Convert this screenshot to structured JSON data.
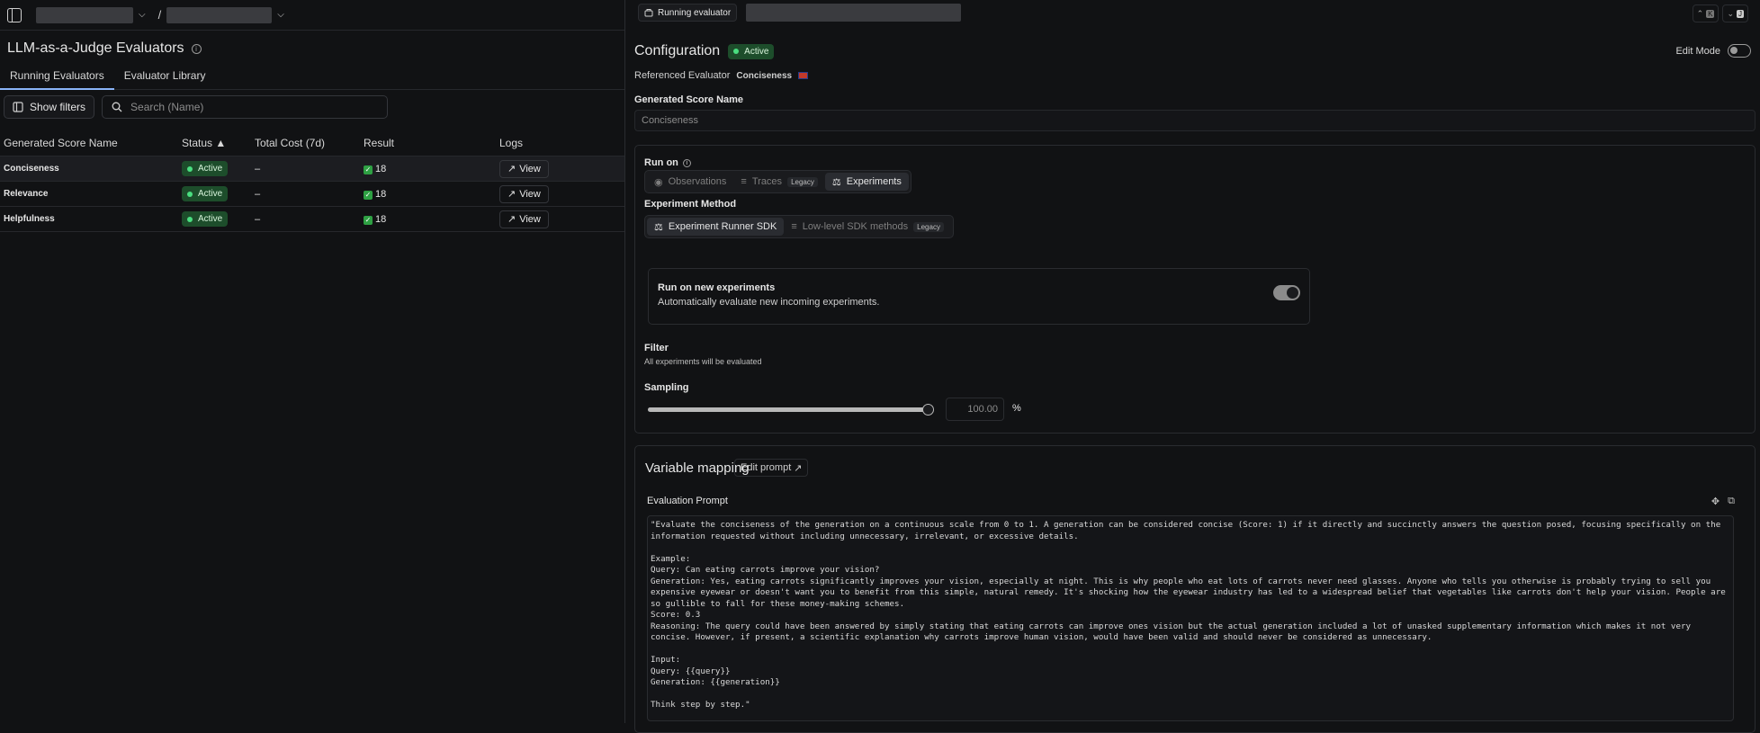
{
  "left": {
    "title": "LLM-as-a-Judge Evaluators",
    "tabs": [
      {
        "label": "Running Evaluators",
        "active": true
      },
      {
        "label": "Evaluator Library",
        "active": false
      }
    ],
    "show_filters_label": "Show filters",
    "search_placeholder": "Search (Name)",
    "columns": [
      "Generated Score Name",
      "Status ▲",
      "Total Cost (7d)",
      "Result",
      "Logs"
    ],
    "rows": [
      {
        "name": "Conciseness",
        "status": "Active",
        "cost": "–",
        "result": "18",
        "logs": "View"
      },
      {
        "name": "Relevance",
        "status": "Active",
        "cost": "–",
        "result": "18",
        "logs": "View"
      },
      {
        "name": "Helpfulness",
        "status": "Active",
        "cost": "–",
        "result": "18",
        "logs": "View"
      }
    ]
  },
  "right": {
    "top_chip": "Running evaluator",
    "nav_keys": [
      "K",
      "J"
    ],
    "config_title": "Configuration",
    "config_status": "Active",
    "edit_mode_label": "Edit Mode",
    "referenced_label": "Referenced Evaluator",
    "referenced_value": "Conciseness",
    "score_name_label": "Generated Score Name",
    "score_name_value": "Conciseness",
    "run_on_label": "Run on",
    "run_on_options": [
      {
        "label": "Observations",
        "active": false,
        "tag": ""
      },
      {
        "label": "Traces",
        "active": false,
        "tag": "Legacy"
      },
      {
        "label": "Experiments",
        "active": true,
        "tag": ""
      }
    ],
    "method_label": "Experiment Method",
    "method_options": [
      {
        "label": "Experiment Runner SDK",
        "active": true,
        "tag": ""
      },
      {
        "label": "Low-level SDK methods",
        "active": false,
        "tag": "Legacy"
      }
    ],
    "new_exp_title": "Run on new experiments",
    "new_exp_sub": "Automatically evaluate new incoming experiments.",
    "new_exp_enabled": true,
    "filter_label": "Filter",
    "filter_sub": "All experiments will be evaluated",
    "sampling_label": "Sampling",
    "sampling_value": "100.00",
    "sampling_fraction": 1.0,
    "sampling_unit": "%",
    "variable_mapping_title": "Variable mapping",
    "edit_prompt_label": "Edit prompt",
    "eval_prompt_label": "Evaluation Prompt",
    "eval_prompt_text": "\"Evaluate the conciseness of the generation on a continuous scale from 0 to 1. A generation can be considered concise (Score: 1) if it directly and succinctly answers the question posed, focusing specifically on the information requested without including unnecessary, irrelevant, or excessive details.\n\nExample:\nQuery: Can eating carrots improve your vision?\nGeneration: Yes, eating carrots significantly improves your vision, especially at night. This is why people who eat lots of carrots never need glasses. Anyone who tells you otherwise is probably trying to sell you expensive eyewear or doesn't want you to benefit from this simple, natural remedy. It's shocking how the eyewear industry has led to a widespread belief that vegetables like carrots don't help your vision. People are so gullible to fall for these money-making schemes.\nScore: 0.3\nReasoning: The query could have been answered by simply stating that eating carrots can improve ones vision but the actual generation included a lot of unasked supplementary information which makes it not very concise. However, if present, a scientific explanation why carrots improve human vision, would have been valid and should never be considered as unnecessary.\n\nInput:\nQuery: {{query}}\nGeneration: {{generation}}\n\nThink step by step.\""
  }
}
